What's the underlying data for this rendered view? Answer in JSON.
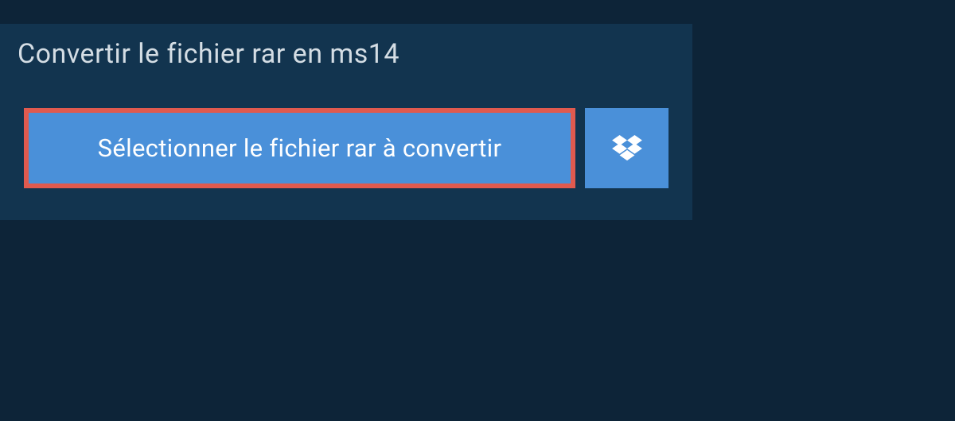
{
  "header": {
    "title": "Convertir le fichier rar en ms14"
  },
  "actions": {
    "select_file_label": "Sélectionner le fichier rar à convertir"
  },
  "colors": {
    "background": "#0d2438",
    "panel": "#12344f",
    "button": "#4a90d9",
    "highlight_border": "#e05a4f",
    "text_light": "#d4dde4",
    "text_white": "#ffffff"
  }
}
